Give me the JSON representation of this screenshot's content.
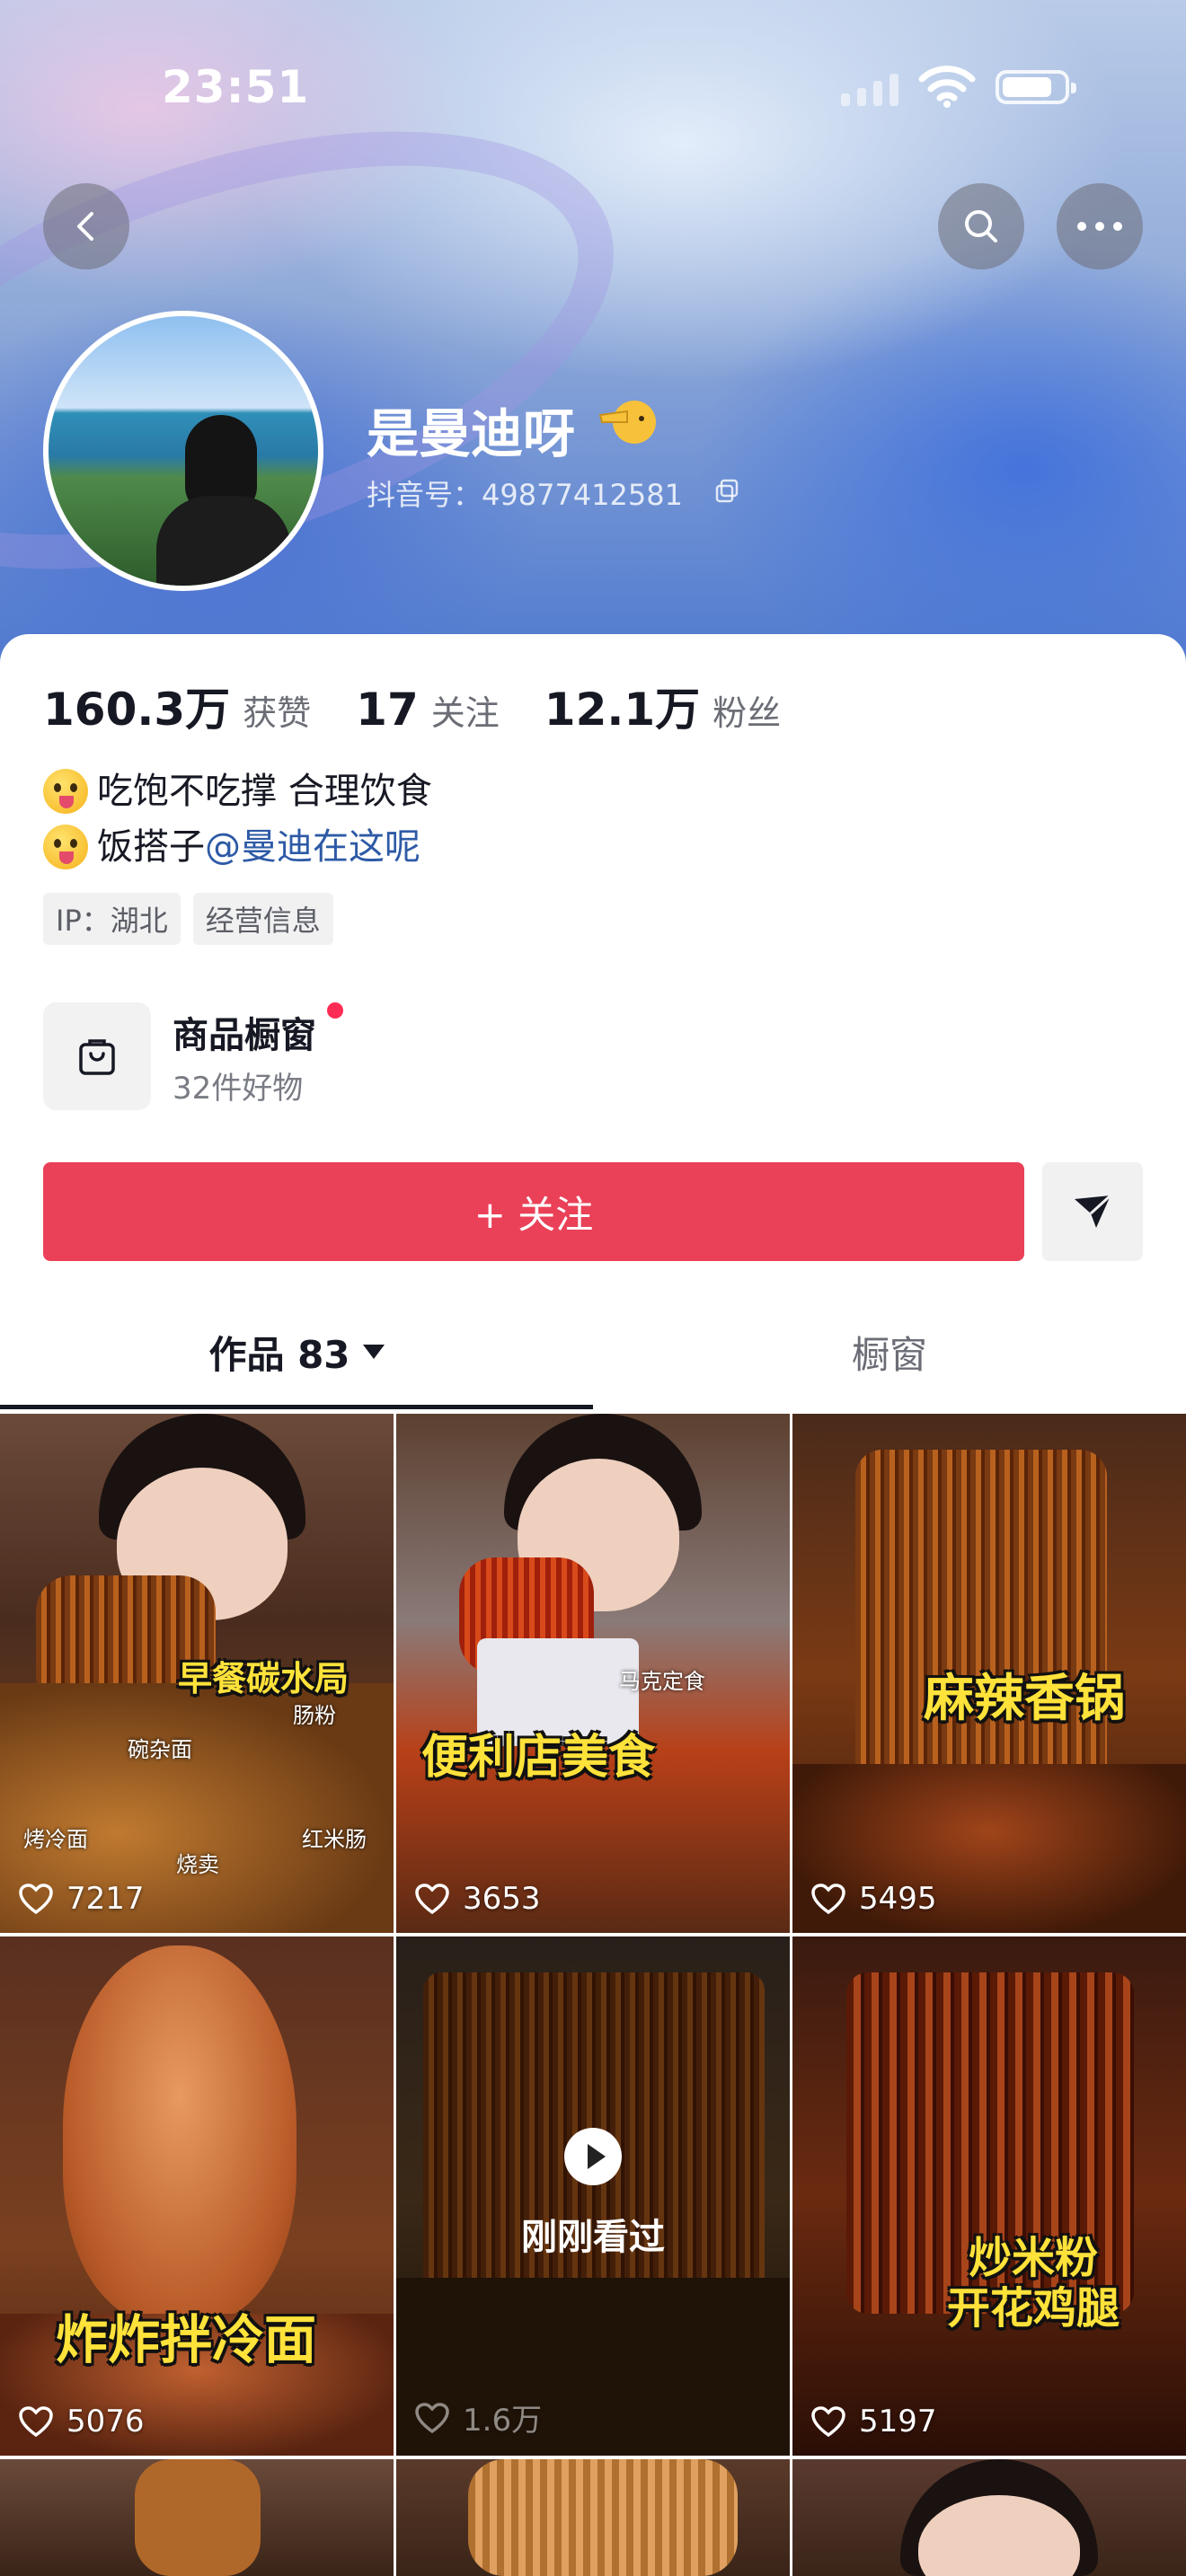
{
  "status_bar": {
    "time": "23:51"
  },
  "profile": {
    "name": "是曼迪呀",
    "douyin_id": "抖音号：49877412581",
    "stats": [
      {
        "value": "160.3万",
        "label": "获赞"
      },
      {
        "value": "17",
        "label": "关注"
      },
      {
        "value": "12.1万",
        "label": "粉丝"
      }
    ],
    "bio": {
      "line1": "吃饱不吃撑 合理饮食",
      "line2_prefix": "饭搭子 ",
      "line2_mention": "@曼迪在这呢"
    },
    "tags": [
      "IP：湖北",
      "经营信息"
    ]
  },
  "shop": {
    "title": "商品橱窗",
    "subtitle": "32件好物"
  },
  "actions": {
    "follow_label": "+ 关注"
  },
  "tabs": {
    "works": "作品 83",
    "shop": "橱窗"
  },
  "videos": [
    {
      "likes": "7217",
      "caption": "早餐碳水局",
      "labels": [
        "碗杂面",
        "肠粉",
        "烤冷面",
        "烧卖",
        "红米肠"
      ]
    },
    {
      "likes": "3653",
      "caption": "便利店美食",
      "labels": [
        "马克定食"
      ]
    },
    {
      "likes": "5495",
      "caption": "麻辣香锅",
      "labels": []
    },
    {
      "likes": "5076",
      "caption": "炸炸拌冷面",
      "labels": []
    },
    {
      "likes": "1.6万",
      "caption": "",
      "overlay": "刚刚看过",
      "labels": []
    },
    {
      "likes": "5197",
      "caption": "炒米粉\n开花鸡腿",
      "labels": []
    }
  ],
  "colors": {
    "accent": "#ea4158",
    "mention": "#2d5aa6",
    "caption": "#ffe23a"
  }
}
